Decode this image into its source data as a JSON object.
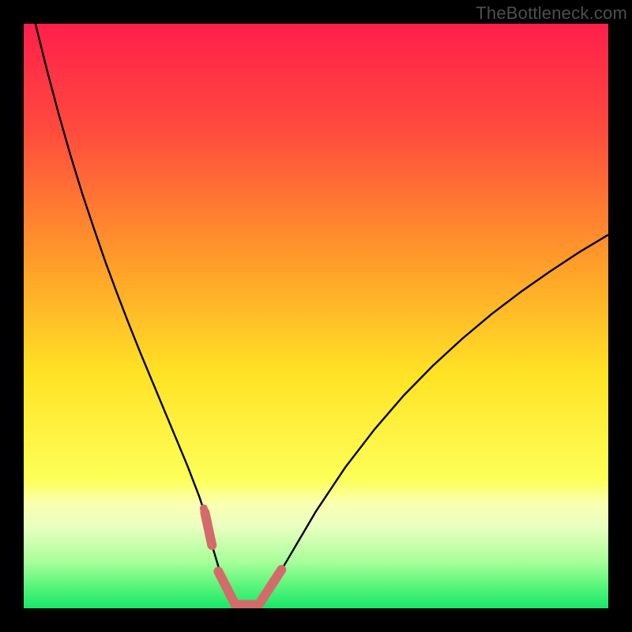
{
  "watermark": "TheBottleneck.com",
  "chart_data": {
    "type": "line",
    "title": "",
    "xlabel": "",
    "ylabel": "",
    "xlim": [
      0,
      100
    ],
    "ylim": [
      0,
      100
    ],
    "background_gradient": {
      "stops": [
        {
          "offset": 0.0,
          "color": "#ff1f4b"
        },
        {
          "offset": 0.18,
          "color": "#ff4a3e"
        },
        {
          "offset": 0.4,
          "color": "#ff9a2a"
        },
        {
          "offset": 0.6,
          "color": "#ffe325"
        },
        {
          "offset": 0.78,
          "color": "#fdff58"
        },
        {
          "offset": 0.82,
          "color": "#fbffb0"
        },
        {
          "offset": 0.86,
          "color": "#e9ffc0"
        },
        {
          "offset": 0.92,
          "color": "#a8ff9a"
        },
        {
          "offset": 0.96,
          "color": "#5cf57c"
        },
        {
          "offset": 1.0,
          "color": "#18e768"
        }
      ]
    },
    "series": [
      {
        "name": "bottleneck-curve",
        "stroke": "#000000",
        "stroke_width": 2.4,
        "x": [
          2,
          4,
          6,
          8,
          10,
          12,
          14,
          16,
          18,
          20,
          22,
          24,
          26,
          28,
          30,
          30.8,
          32,
          34,
          36,
          38,
          40,
          42,
          45,
          50,
          55,
          60,
          65,
          70,
          75,
          80,
          85,
          90,
          95,
          100
        ],
        "y": [
          100,
          92,
          84.5,
          77.5,
          71,
          65,
          59.2,
          53.8,
          48.6,
          43.6,
          38.8,
          34,
          29.2,
          24.4,
          19.2,
          16.8,
          11.5,
          4.8,
          0.5,
          0,
          0.5,
          3.1,
          8.1,
          16.6,
          24.1,
          30.6,
          36.4,
          41.5,
          46.1,
          50.3,
          54.1,
          57.6,
          60.9,
          63.9
        ]
      }
    ],
    "overlay_markers": {
      "name": "highlight-region",
      "stroke": "#d46b6b",
      "stroke_width": 12,
      "cap": "round",
      "segments": [
        {
          "x": [
            31.0,
            32.2
          ],
          "y": [
            16.4,
            10.8
          ]
        },
        {
          "x": [
            33.3,
            36.2
          ],
          "y": [
            6.3,
            0.6
          ]
        },
        {
          "x": [
            36.2,
            40.2
          ],
          "y": [
            0.6,
            0.6
          ]
        },
        {
          "x": [
            40.2,
            44.1
          ],
          "y": [
            0.6,
            6.6
          ]
        }
      ],
      "dot": {
        "x": 30.8,
        "y": 17.1,
        "r": 5
      }
    }
  }
}
